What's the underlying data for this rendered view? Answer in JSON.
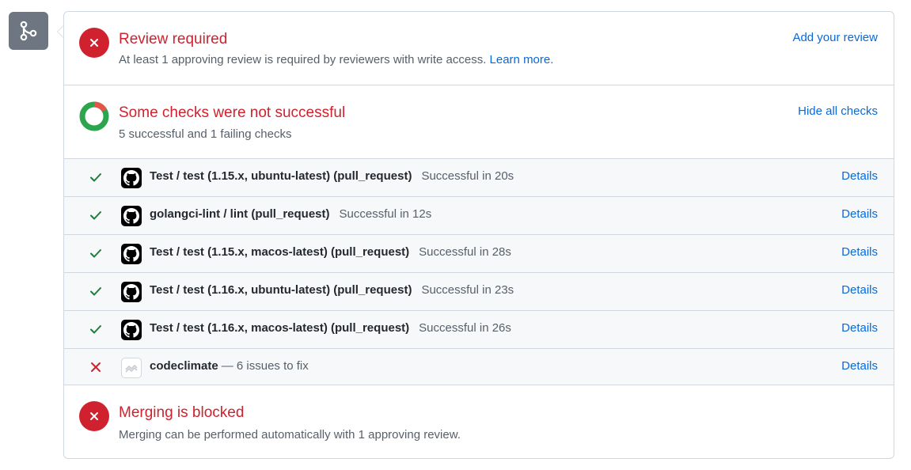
{
  "colors": {
    "danger": "#cf222e",
    "success": "#1a7f37",
    "link": "#0969da",
    "muted": "#57606a",
    "border": "#d0d7de"
  },
  "merge_icon": "git-merge-icon",
  "review": {
    "title": "Review required",
    "description": "At least 1 approving review is required by reviewers with write access.",
    "learn_more": "Learn more.",
    "action": "Add your review"
  },
  "checks": {
    "title": "Some checks were not successful",
    "summary": "5 successful and 1 failing checks",
    "action": "Hide all checks",
    "successful": 5,
    "failing": 1,
    "items": [
      {
        "status": "success",
        "avatar": "github-icon",
        "name": "Test / test (1.15.x, ubuntu-latest) (pull_request)",
        "description": "Successful in 20s",
        "details": "Details"
      },
      {
        "status": "success",
        "avatar": "github-icon",
        "name": "golangci-lint / lint (pull_request)",
        "description": "Successful in 12s",
        "details": "Details"
      },
      {
        "status": "success",
        "avatar": "github-icon",
        "name": "Test / test (1.15.x, macos-latest) (pull_request)",
        "description": "Successful in 28s",
        "details": "Details"
      },
      {
        "status": "success",
        "avatar": "github-icon",
        "name": "Test / test (1.16.x, ubuntu-latest) (pull_request)",
        "description": "Successful in 23s",
        "details": "Details"
      },
      {
        "status": "success",
        "avatar": "github-icon",
        "name": "Test / test (1.16.x, macos-latest) (pull_request)",
        "description": "Successful in 26s",
        "details": "Details"
      },
      {
        "status": "failure",
        "avatar": "codeclimate-icon",
        "name": "codeclimate",
        "description": "— 6 issues to fix",
        "details": "Details"
      }
    ]
  },
  "merge": {
    "title": "Merging is blocked",
    "description": "Merging can be performed automatically with 1 approving review."
  }
}
